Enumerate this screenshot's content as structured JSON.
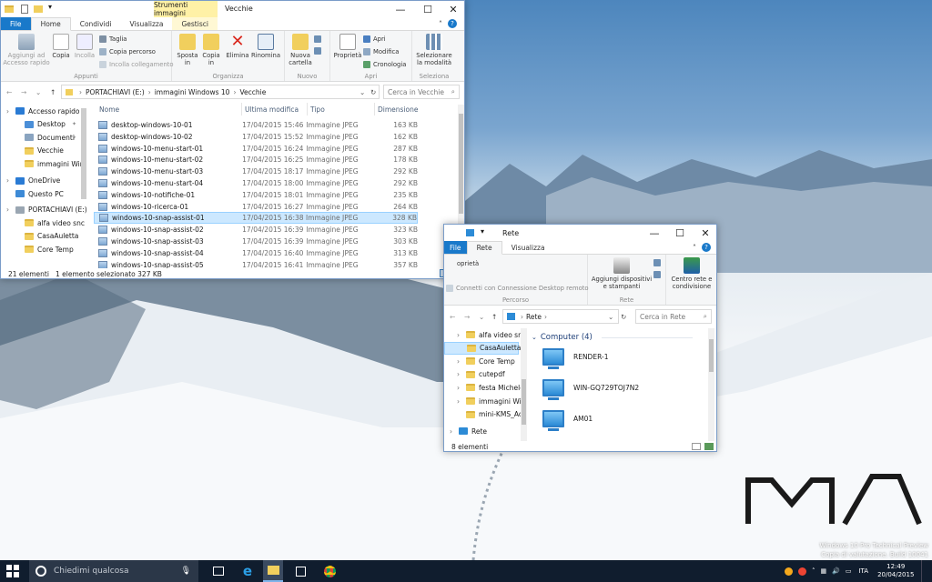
{
  "desktop": {
    "watermark_line1": "Windows 10 Pro Technical Preview",
    "watermark_line2": "Copia di valutazione. Build 10041"
  },
  "explorer1": {
    "tool_tab": "Strumenti immagini",
    "title": "Vecchie",
    "tabs": [
      "File",
      "Home",
      "Condividi",
      "Visualizza",
      "Gestisci"
    ],
    "ribbon": {
      "appunti": {
        "label": "Appunti",
        "pin": "Aggiungi ad\nAccesso rapido",
        "copy": "Copia",
        "paste": "Incolla",
        "cut": "Taglia",
        "copy_path": "Copia percorso",
        "paste_link": "Incolla collegamento"
      },
      "organizza": {
        "label": "Organizza",
        "move": "Sposta\nin",
        "copy_to": "Copia\nin",
        "delete": "Elimina",
        "rename": "Rinomina"
      },
      "nuovo": {
        "label": "Nuovo",
        "new_folder": "Nuova\ncartella"
      },
      "apri": {
        "label": "Apri",
        "properties": "Proprietà",
        "open": "Apri",
        "edit": "Modifica",
        "history": "Cronologia"
      },
      "seleziona": {
        "label": "Seleziona",
        "select_mode": "Selezionare\nla modalità"
      }
    },
    "address": {
      "crumbs": [
        "PORTACHIAVI (E:)",
        "immagini Windows 10",
        "Vecchie"
      ],
      "search_placeholder": "Cerca in Vecchie"
    },
    "nav": [
      {
        "label": "Accesso rapido",
        "icon": "star"
      },
      {
        "label": "Desktop",
        "icon": "folder-blue"
      },
      {
        "label": "Documenti",
        "icon": "documents"
      },
      {
        "label": "Vecchie",
        "icon": "folder"
      },
      {
        "label": "immagini Win",
        "icon": "folder"
      },
      {
        "label": "OneDrive",
        "icon": "cloud"
      },
      {
        "label": "Questo PC",
        "icon": "pc"
      },
      {
        "label": "PORTACHIAVI (E:)",
        "icon": "drive"
      },
      {
        "label": "alfa video snc",
        "icon": "folder"
      },
      {
        "label": "CasaAuletta",
        "icon": "folder"
      },
      {
        "label": "Core Temp",
        "icon": "folder"
      }
    ],
    "columns": [
      "Nome",
      "Ultima modifica",
      "Tipo",
      "Dimensione"
    ],
    "files": [
      [
        "desktop-windows-10-01",
        "17/04/2015 15:46",
        "Immagine JPEG",
        "163 KB"
      ],
      [
        "desktop-windows-10-02",
        "17/04/2015 15:52",
        "Immagine JPEG",
        "162 KB"
      ],
      [
        "windows-10-menu-start-01",
        "17/04/2015 16:24",
        "Immagine JPEG",
        "287 KB"
      ],
      [
        "windows-10-menu-start-02",
        "17/04/2015 16:25",
        "Immagine JPEG",
        "178 KB"
      ],
      [
        "windows-10-menu-start-03",
        "17/04/2015 18:17",
        "Immagine JPEG",
        "292 KB"
      ],
      [
        "windows-10-menu-start-04",
        "17/04/2015 18:00",
        "Immagine JPEG",
        "292 KB"
      ],
      [
        "windows-10-notifiche-01",
        "17/04/2015 18:01",
        "Immagine JPEG",
        "235 KB"
      ],
      [
        "windows-10-ricerca-01",
        "17/04/2015 16:27",
        "Immagine JPEG",
        "264 KB"
      ],
      [
        "windows-10-snap-assist-01",
        "17/04/2015 16:38",
        "Immagine JPEG",
        "328 KB"
      ],
      [
        "windows-10-snap-assist-02",
        "17/04/2015 16:39",
        "Immagine JPEG",
        "323 KB"
      ],
      [
        "windows-10-snap-assist-03",
        "17/04/2015 16:39",
        "Immagine JPEG",
        "303 KB"
      ],
      [
        "windows-10-snap-assist-04",
        "17/04/2015 16:40",
        "Immagine JPEG",
        "313 KB"
      ],
      [
        "windows-10-snap-assist-05",
        "17/04/2015 16:41",
        "Immagine JPEG",
        "357 KB"
      ]
    ],
    "selected_index": 8,
    "status_count": "21 elementi",
    "status_selected": "1 elemento selezionato  327 KB"
  },
  "explorer2": {
    "title": "Rete",
    "tabs": [
      "File",
      "Rete",
      "Visualizza"
    ],
    "ribbon": {
      "properties_partial": "oprietà",
      "remote": "Connetti con Connessione Desktop remoto",
      "percorso_label": "Percorso",
      "add_devices": "Aggiungi dispositivi\ne stampanti",
      "rete_label": "Rete",
      "network_center": "Centro rete e\ncondivisione"
    },
    "address": {
      "crumbs": [
        "Rete"
      ],
      "search_placeholder": "Cerca in Rete"
    },
    "nav": [
      "alfa video snc",
      "CasaAuletta",
      "Core Temp",
      "cutepdf",
      "festa Michele",
      "immagini Win",
      "mini-KMS_Act",
      "Rete"
    ],
    "nav_selected": 1,
    "group_header": "Computer (4)",
    "computers": [
      "RENDER-1",
      "WIN-GQ729TOJ7N2",
      "AM01"
    ],
    "status_count": "8 elementi"
  },
  "taskbar": {
    "search_placeholder": "Chiedimi qualcosa",
    "language": "ITA",
    "time": "12:49",
    "date": "20/04/2015"
  },
  "colors": {
    "accent": "#1979ca",
    "tool_tab": "#fff1a6",
    "selection": "#cce8ff",
    "taskbar": "#101d2e"
  }
}
